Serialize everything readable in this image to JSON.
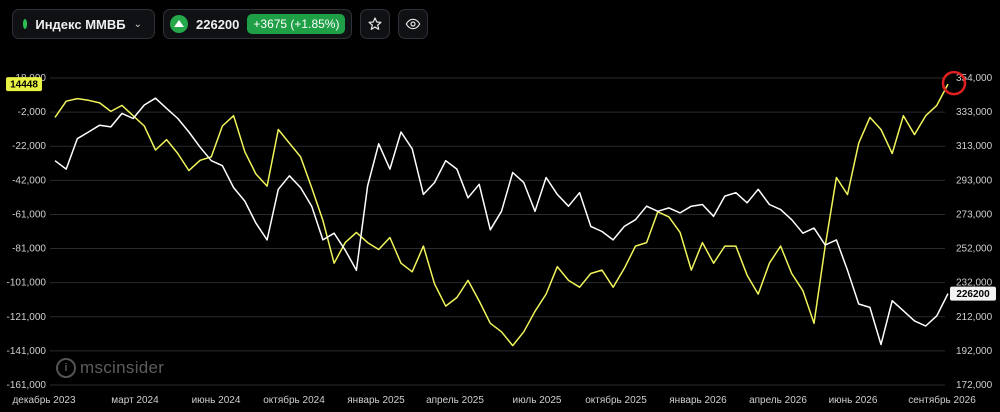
{
  "toolbar": {
    "instrument_name": "Индекс ММВБ",
    "price": "226200",
    "change": "+3675 (+1.85%)"
  },
  "watermark": "mscinsider",
  "colors": {
    "background": "#000000",
    "series_yellow": "#f0f55a",
    "series_white": "#ffffff",
    "positive": "#1f9f46",
    "highlight_circle": "#e02020"
  },
  "icons": [
    "chevron-down-icon",
    "triangle-up-icon",
    "star-icon",
    "eye-icon"
  ],
  "chart_data": {
    "type": "line",
    "x_labels": [
      "декабрь 2023",
      "март 2024",
      "июнь 2024",
      "октябрь 2024",
      "январь 2025",
      "апрель 2025",
      "июль 2025",
      "октябрь 2025",
      "январь 2026",
      "апрель 2026",
      "июнь 2026",
      "сентябрь 2026"
    ],
    "left_axis": {
      "ticks": [
        "18,000",
        "-2,000",
        "-22,000",
        "-42,000",
        "-61,000",
        "-81,000",
        "-101,000",
        "-121,000",
        "-141,000",
        "-161,000"
      ],
      "ylim": [
        -161000,
        18000
      ]
    },
    "right_axis": {
      "ticks": [
        "354,000",
        "333,000",
        "313,000",
        "293,000",
        "273,000",
        "252,000",
        "232,000",
        "212,000",
        "192,000",
        "172,000"
      ],
      "ylim": [
        172000,
        354000
      ]
    },
    "last_value_left": "14448",
    "last_value_right": "226200",
    "grid": "horizontal",
    "series": [
      {
        "axis": "left",
        "color": "#f0f55a",
        "values": [
          -5000,
          4500,
          6000,
          5000,
          3500,
          -1500,
          2000,
          -4000,
          -10000,
          -24000,
          -18000,
          -26000,
          -36000,
          -30000,
          -28000,
          -10000,
          -4000,
          -25000,
          -38000,
          -45000,
          -12000,
          -20000,
          -28000,
          -46000,
          -65000,
          -90000,
          -78000,
          -72000,
          -78000,
          -82000,
          -75000,
          -90000,
          -95000,
          -80000,
          -102000,
          -115000,
          -110000,
          -100000,
          -112000,
          -125000,
          -130000,
          -138000,
          -130000,
          -118000,
          -108000,
          -92000,
          -100000,
          -104000,
          -96000,
          -94000,
          -104000,
          -93000,
          -80000,
          -78000,
          -60000,
          -63000,
          -72000,
          -94000,
          -78000,
          -90000,
          -80000,
          -80000,
          -97000,
          -108000,
          -90000,
          -80000,
          -96000,
          -106000,
          -125000,
          -80000,
          -40000,
          -50000,
          -20000,
          -5000,
          -12000,
          -26000,
          -4000,
          -15000,
          -4000,
          2000,
          14448
        ]
      },
      {
        "axis": "right",
        "color": "#ffffff",
        "values": [
          305000,
          300000,
          318000,
          322000,
          326000,
          325000,
          333000,
          330000,
          338000,
          342000,
          336000,
          330000,
          322000,
          313000,
          305000,
          302000,
          289000,
          281000,
          268000,
          258000,
          288000,
          296000,
          289000,
          278000,
          258000,
          262000,
          252000,
          240000,
          290000,
          315000,
          300000,
          322000,
          312000,
          285000,
          292000,
          305000,
          300000,
          283000,
          291000,
          264000,
          275000,
          298000,
          292000,
          275000,
          295000,
          285000,
          278000,
          286000,
          266000,
          263000,
          258000,
          266000,
          270000,
          278000,
          275000,
          277000,
          274000,
          278000,
          279000,
          272000,
          284000,
          286000,
          280000,
          288000,
          279000,
          276000,
          270000,
          262000,
          265000,
          255000,
          258000,
          240000,
          220000,
          218000,
          196000,
          222000,
          216000,
          210000,
          207000,
          213000,
          226200
        ]
      }
    ]
  }
}
